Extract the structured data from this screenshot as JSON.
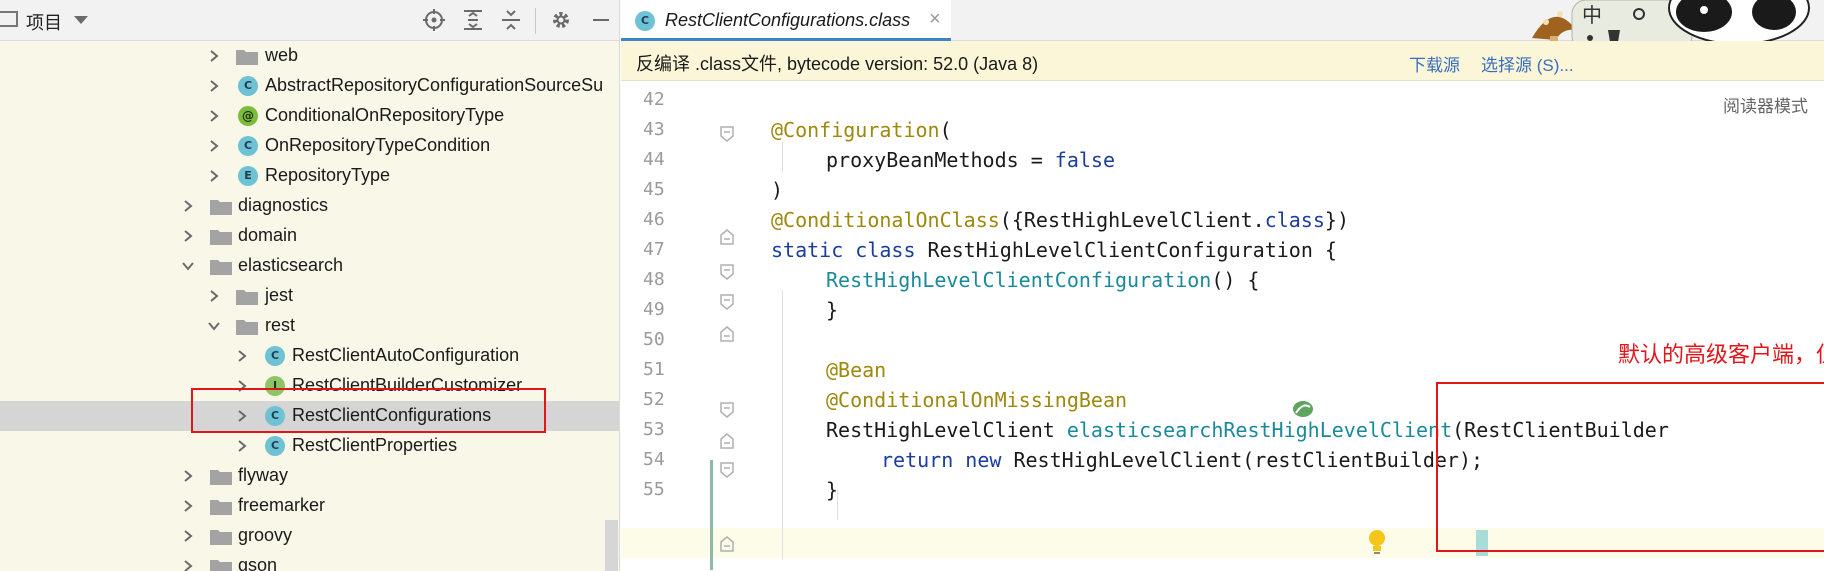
{
  "project_panel": {
    "title": "项目",
    "tree": [
      {
        "label": "web",
        "kind": "folder"
      },
      {
        "label": "AbstractRepositoryConfigurationSourceSu",
        "kind": "class",
        "badge": "C"
      },
      {
        "label": "ConditionalOnRepositoryType",
        "kind": "annotation",
        "badge": "@"
      },
      {
        "label": "OnRepositoryTypeCondition",
        "kind": "class",
        "badge": "C"
      },
      {
        "label": "RepositoryType",
        "kind": "enum",
        "badge": "E"
      },
      {
        "label": "diagnostics",
        "kind": "folder"
      },
      {
        "label": "domain",
        "kind": "folder"
      },
      {
        "label": "elasticsearch",
        "kind": "folder",
        "expanded": true
      },
      {
        "label": "jest",
        "kind": "folder"
      },
      {
        "label": "rest",
        "kind": "folder",
        "expanded": true
      },
      {
        "label": "RestClientAutoConfiguration",
        "kind": "class",
        "badge": "C"
      },
      {
        "label": "RestClientBuilderCustomizer",
        "kind": "interface",
        "badge": "I"
      },
      {
        "label": "RestClientConfigurations",
        "kind": "class",
        "badge": "C",
        "selected": true
      },
      {
        "label": "RestClientProperties",
        "kind": "class",
        "badge": "C"
      },
      {
        "label": "flyway",
        "kind": "folder"
      },
      {
        "label": "freemarker",
        "kind": "folder"
      },
      {
        "label": "groovy",
        "kind": "folder"
      },
      {
        "label": "gson",
        "kind": "folder"
      }
    ]
  },
  "editor": {
    "tab_label": "RestClientConfigurations.class",
    "tab_badge": "C",
    "close_glyph": "×",
    "mascot_text": "中",
    "infobar_text": "反编译 .class文件, bytecode version: 52.0 (Java 8)",
    "download_sources": "下载源",
    "choose_sources": "选择源 (S)...",
    "reader_mode": "阅读器模式",
    "line_numbers": [
      "42",
      "43",
      "44",
      "45",
      "46",
      "47",
      "48",
      "49",
      "50",
      "51",
      "52",
      "53",
      "54",
      "55"
    ],
    "annotation": "默认的高级客户端，但是我们刚刚自己配了一个，就不会再用这个默认的了",
    "code": {
      "l43_ann": "@Configuration",
      "l43_rest": "(",
      "l44_a": "proxyBeanMethods = ",
      "l44_b": "false",
      "l45": ")",
      "l46_ann": "@ConditionalOnClass",
      "l46_a": "({RestHighLevelClient.",
      "l46_kw": "class",
      "l46_b": "})",
      "l47_kw": "static class ",
      "l47_rest": "RestHighLevelClientConfiguration {",
      "l48_fn": "RestHighLevelClientConfiguration",
      "l48_rest": "() {",
      "l49": "}",
      "l51": "@Bean",
      "l52": "@ConditionalOnMissingBean",
      "l53_a": "RestHighLevelClient ",
      "l53_fn": "elasticsearchRestHighLevelClient",
      "l53_b": "(RestClientBuilder",
      "l54_kw": "return new ",
      "l54_rest": "RestHighLevelClient(restClientBuilder);",
      "l55": "}"
    }
  },
  "colors": {
    "annotation": "#9e880d",
    "keyword": "#1b3e9e",
    "method": "#1a8a9a",
    "highlight_box": "#e0161b",
    "link": "#3a6ec0"
  }
}
